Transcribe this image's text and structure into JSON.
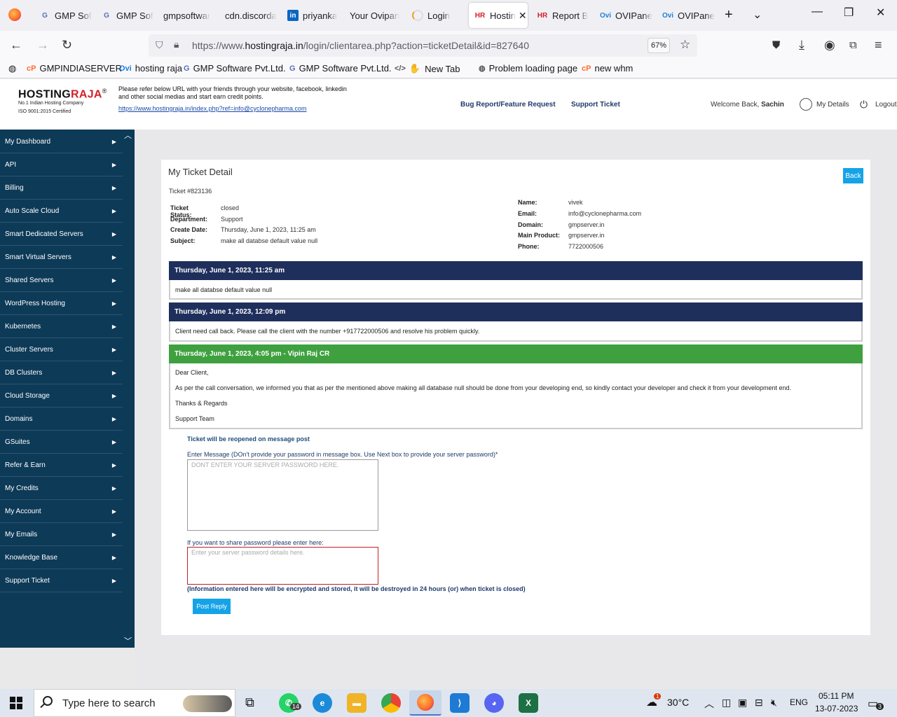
{
  "browser": {
    "tabs": [
      {
        "label": "GMP Sof",
        "icon": "gmp-favicon"
      },
      {
        "label": "GMP Sof",
        "icon": "gmp-favicon"
      },
      {
        "label": "gmpsoftwar",
        "icon": ""
      },
      {
        "label": "cdn.discorda",
        "icon": ""
      },
      {
        "label": "priyanka",
        "icon": "linkedin-favicon"
      },
      {
        "label": "Your Ovipan",
        "icon": ""
      },
      {
        "label": "Login",
        "icon": "loading-icon"
      },
      {
        "label": "Hostin",
        "icon": "hr-favicon"
      },
      {
        "label": "Report B",
        "icon": "hr-favicon"
      },
      {
        "label": "OVIPane",
        "icon": "ovi-favicon"
      },
      {
        "label": "OVIPane",
        "icon": "ovi-favicon"
      }
    ],
    "url_prefix": "https://www.",
    "url_host": "hostingraja.in",
    "url_path": "/login/clientarea.php?action=ticketDetail&id=827640",
    "zoom": "67%",
    "bookmarks": [
      {
        "label": "GMPINDIASERVER",
        "icon": "cp-icon"
      },
      {
        "label": "hosting raja",
        "icon": "ovi-icon"
      },
      {
        "label": "GMP Software Pvt.Ltd.",
        "icon": "gmp-icon"
      },
      {
        "label": "GMP Software Pvt.Ltd.",
        "icon": "gmp-icon"
      },
      {
        "label": "New Tab",
        "icon": "code-icon"
      },
      {
        "label": "Problem loading page",
        "icon": "globe-icon"
      },
      {
        "label": "new whm",
        "icon": "cp-icon"
      }
    ]
  },
  "header": {
    "logo_hosting": "HOSTING",
    "logo_raja": "RAJA",
    "logo_reg": "®",
    "logo_sub1": "No.1 Indian Hosting Company",
    "logo_sub2": "ISO 9001:2015 Certified",
    "refer_text": "Please refer below URL with your friends through your website, facebook, linkedin and other social medias and start earn credit points.",
    "refer_link": "https://www.hostingraja.in/index.php?ref=info@cyclonepharma.com",
    "bug_report": "Bug Report/Feature Request",
    "support_ticket": "Support Ticket",
    "welcome": "Welcome Back,",
    "user": "Sachin",
    "my_details": "My Details",
    "logout": "Logout"
  },
  "sidebar": {
    "items": [
      "My Dashboard",
      "API",
      "Billing",
      "Auto Scale Cloud",
      "Smart Dedicated Servers",
      "Smart Virtual Servers",
      "Shared Servers",
      "WordPress Hosting",
      "Kubernetes",
      "Cluster Servers",
      "DB Clusters",
      "Cloud Storage",
      "Domains",
      "GSuites",
      "Refer & Earn",
      "My Credits",
      "My Account",
      "My Emails",
      "Knowledge Base",
      "Support Ticket"
    ]
  },
  "ticket": {
    "title": "My Ticket Detail",
    "back": "Back",
    "number": "Ticket #823136",
    "left_info": [
      {
        "label": "Ticket Status:",
        "value": "closed"
      },
      {
        "label": "Department:",
        "value": "Support"
      },
      {
        "label": "Create Date:",
        "value": "Thursday, June 1, 2023, 11:25 am"
      },
      {
        "label": "Subject:",
        "value": "make all databse default value null"
      }
    ],
    "right_info": [
      {
        "label": "Name:",
        "value": "vivek"
      },
      {
        "label": "Email:",
        "value": "info@cyclonepharma.com"
      },
      {
        "label": "Domain:",
        "value": "gmpserver.in"
      },
      {
        "label": "Main Product:",
        "value": "gmpserver.in"
      },
      {
        "label": "Phone:",
        "value": "7722000506"
      }
    ],
    "messages": [
      {
        "header": "Thursday, June 1, 2023, 11:25 am",
        "lines": [
          "make all databse default value null"
        ]
      },
      {
        "header": "Thursday, June 1, 2023, 12:09 pm",
        "lines": [
          "Client need call back. Please call the client with the number +917722000506 and resolve his problem quickly."
        ]
      },
      {
        "header": "Thursday, June 1, 2023, 4:05 pm - Vipin Raj CR",
        "lines": [
          "Dear Client,",
          "As per the call conversation, we informed you that as per the mentioned above making all database null should be done from your developing end, so kindly contact your developer and check it from your development end.",
          "Thanks & Regards",
          "Support Team"
        ]
      }
    ],
    "reopen_note": "Ticket will be reopened on message post",
    "message_label": "Enter Message (DOn't provide your password in message box. Use Next box to provide your server password)*",
    "message_placeholder": "DONT ENTER YOUR SERVER PASSWORD HERE.",
    "password_label": "If you want to share password please enter here:",
    "password_placeholder": "Enter your server password details here.",
    "encrypt_note": "(Information entered here will be encrypted and stored, it will be destroyed in 24 hours (or) when ticket is closed)",
    "post_button": "Post Reply"
  },
  "taskbar": {
    "search_placeholder": "Type here to search",
    "whatsapp_badge": "14",
    "weather": "30°C",
    "weather_badge": "1",
    "lang": "ENG",
    "time": "05:11 PM",
    "date": "13-07-2023",
    "notif_count": "3"
  },
  "colors": {
    "sidebar_bg": "#0d3a57",
    "client_msg_head": "#1f2f5c",
    "staff_msg_head": "#3fa03f",
    "button_blue": "#15a3e8",
    "brand_red": "#d3202a"
  }
}
